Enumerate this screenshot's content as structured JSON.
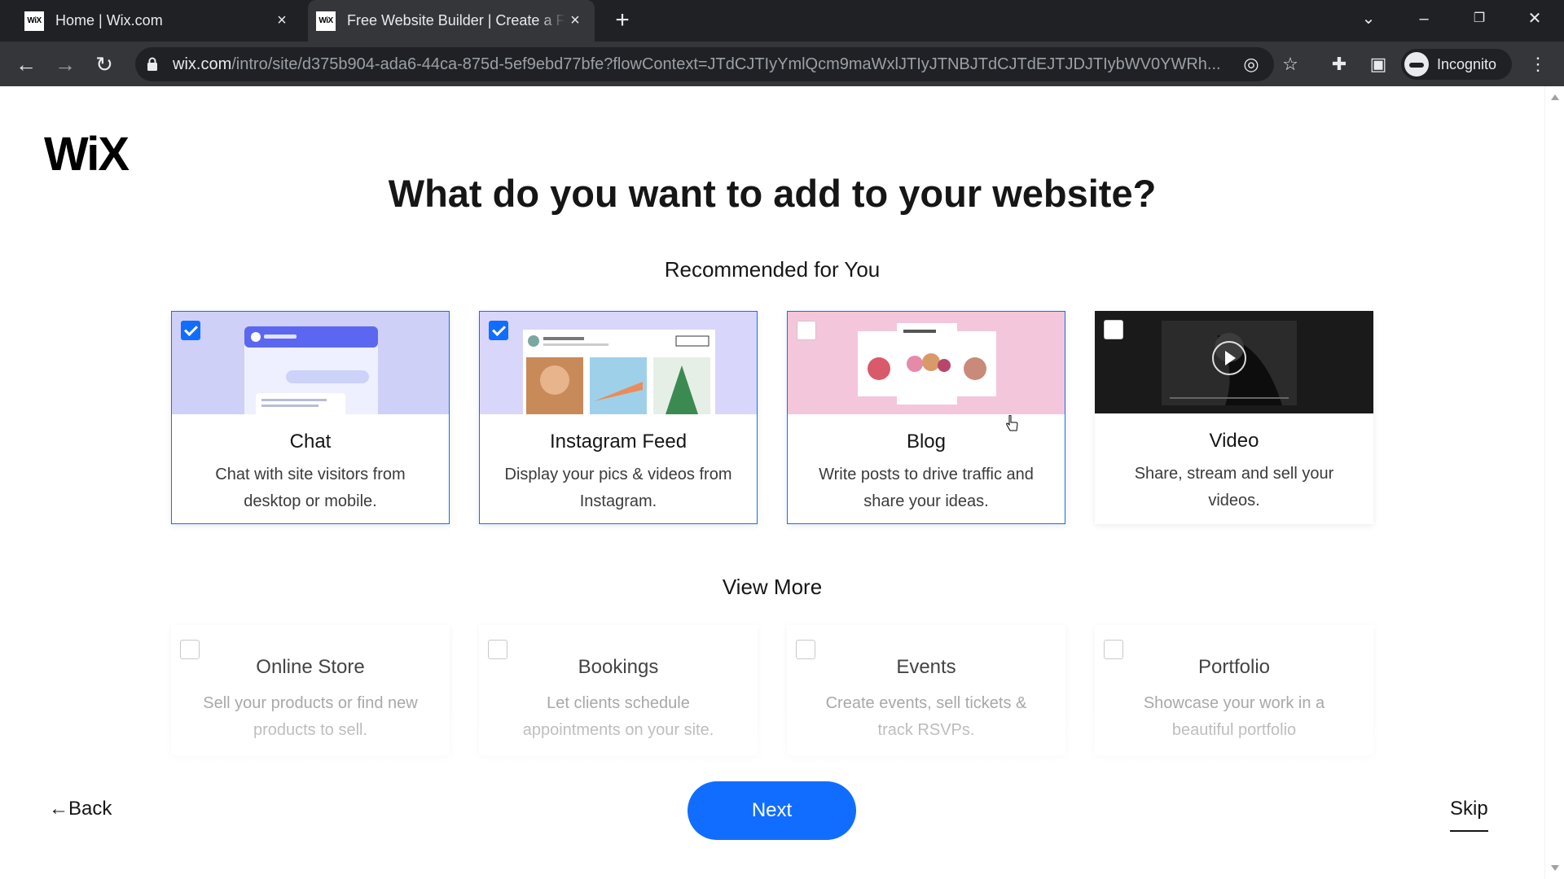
{
  "browser": {
    "tabs": [
      {
        "favicon": "WiX",
        "title": "Home | Wix.com"
      },
      {
        "favicon": "WiX",
        "title": "Free Website Builder | Create a Free Website"
      }
    ],
    "url_host": "wix.com",
    "url_path": "/intro/site/d375b904-ada6-44ca-875d-5ef9ebd77bfe?flowContext=JTdCJTIyYmlQcm9maWxlJTIyJTNBJTdCJTdEJTJDJTIybWV0YWRh...",
    "profile_label": "Incognito",
    "icons": {
      "close": "×",
      "new_tab": "+",
      "back": "←",
      "forward": "→",
      "reload": "↻",
      "tab_search": "⌄",
      "minimize": "–",
      "restore": "❐",
      "window_close": "✕",
      "eye_off": "◎",
      "star": "☆",
      "extensions": "✚",
      "sidepanel": "▣",
      "menu": "⋮"
    }
  },
  "page": {
    "logo": "WiX",
    "heading": "What do you want to add to your website?",
    "recommended_title": "Recommended for You",
    "recommended": [
      {
        "title": "Chat",
        "description": "Chat with site visitors from desktop or mobile.",
        "checked": true
      },
      {
        "title": "Instagram Feed",
        "description": "Display your pics & videos from Instagram.",
        "checked": true
      },
      {
        "title": "Blog",
        "description": "Write posts to drive traffic and share your ideas.",
        "checked": false
      },
      {
        "title": "Video",
        "description": "Share, stream and sell your videos.",
        "checked": false
      }
    ],
    "more_title": "View More",
    "more": [
      {
        "title": "Online Store",
        "description": "Sell your products or find new products to sell.",
        "checked": false
      },
      {
        "title": "Bookings",
        "description": "Let clients schedule appointments on your site.",
        "checked": false
      },
      {
        "title": "Events",
        "description": "Create events, sell tickets & track RSVPs.",
        "checked": false
      },
      {
        "title": "Portfolio",
        "description": "Showcase your work in a beautiful portfolio",
        "checked": false
      }
    ],
    "back_label": "←Back",
    "next_label": "Next",
    "skip_label": "Skip"
  },
  "colors": {
    "accent": "#116dff",
    "chat_bg": "#cfd0f7",
    "instagram_bg": "#d9d6fb",
    "blog_bg": "#f3c6dc",
    "video_bg": "#1a1a1a"
  }
}
